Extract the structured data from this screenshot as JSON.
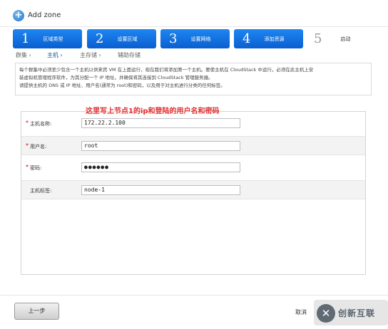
{
  "header": {
    "title": "Add zone"
  },
  "steps": [
    {
      "num": "1",
      "label": "区域类型",
      "state": "done"
    },
    {
      "num": "2",
      "label": "设置区域",
      "state": "done"
    },
    {
      "num": "3",
      "label": "设置网络",
      "state": "done"
    },
    {
      "num": "4",
      "label": "添加资源",
      "state": "active"
    },
    {
      "num": "5",
      "label": "启动",
      "state": "inactive"
    }
  ],
  "subtabs": [
    {
      "label": "群集 ›"
    },
    {
      "label": "主机 ›"
    },
    {
      "label": "主存储 ›"
    },
    {
      "label": "辅助存储"
    }
  ],
  "description": {
    "line1": "每个群集中必须至少包含一个主机以供来宾 VM 在上面运行，现在我们将添加第一个主机。要使主机在 CloudStack 中运行，必须在此主机上安",
    "line2": "装虚拟机管理程序软件，为其分配一个 IP 地址，并确保将其连接到 CloudStack 管理服务器。",
    "line3": "请提供主机的 DNS 或 IP 地址、用户名(通常为 root)和密码，以及用于对主机进行分类的任何标签。"
  },
  "annotation": "这里写上节点1的ip和登陆的用户名和密码",
  "form": {
    "hostname": {
      "required_mark": "*",
      "label": "主机名称:",
      "value": "172.22.2.100"
    },
    "username": {
      "required_mark": "*",
      "label": "用户名:",
      "value": "root"
    },
    "password": {
      "required_mark": "*",
      "label": "密码:",
      "value": "●●●●●●"
    },
    "hosttags": {
      "label": "主机标签:",
      "value": "node-1"
    }
  },
  "footer": {
    "back_label": "上一步",
    "cancel_label": "取消"
  },
  "watermark": {
    "text": "创新互联"
  },
  "colors": {
    "step_blue": "#0a6fe0",
    "annotation_red": "#e03030",
    "required_red": "#d00000"
  }
}
